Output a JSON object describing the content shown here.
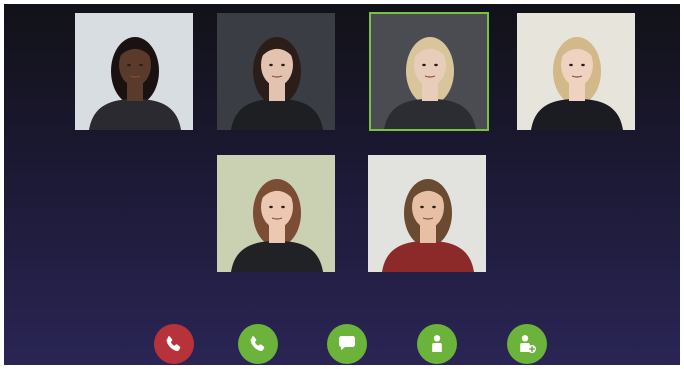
{
  "participants": [
    {
      "id": "p1",
      "skin": "#5a3a2a",
      "hair": "#1a1210",
      "shirt": "#2a2a30",
      "bg": "#d8dde2"
    },
    {
      "id": "p2",
      "skin": "#e4c2b0",
      "hair": "#2b1e18",
      "shirt": "#1d1f22",
      "bg": "#3a3d44"
    },
    {
      "id": "p3",
      "skin": "#e8cdbb",
      "hair": "#d9c59a",
      "shirt": "#2b2d33",
      "bg": "#4a4c52",
      "active": true
    },
    {
      "id": "p4",
      "skin": "#efd2c0",
      "hair": "#d3b889",
      "shirt": "#1b1c22",
      "bg": "#e7e4dc"
    },
    {
      "id": "p5",
      "skin": "#ecc7b2",
      "hair": "#7a4d34",
      "shirt": "#202226",
      "bg": "#c9d1b2"
    },
    {
      "id": "p6",
      "skin": "#e6bfa4",
      "hair": "#6a4a30",
      "shirt": "#8c2a2a",
      "bg": "#e2e2df"
    }
  ],
  "controls": [
    {
      "name": "end-call-button",
      "icon": "phone-hangup-icon",
      "color": "#b8323a"
    },
    {
      "name": "call-button",
      "icon": "phone-icon",
      "color": "#6bb33a"
    },
    {
      "name": "chat-button",
      "icon": "chat-bubble-icon",
      "color": "#6bb33a"
    },
    {
      "name": "participant-button",
      "icon": "user-icon",
      "color": "#6bb33a"
    },
    {
      "name": "add-participant-button",
      "icon": "add-user-icon",
      "color": "#6bb33a"
    }
  ],
  "colors": {
    "accent": "#6bb33a",
    "danger": "#b8323a",
    "active_border": "#7bc043"
  }
}
